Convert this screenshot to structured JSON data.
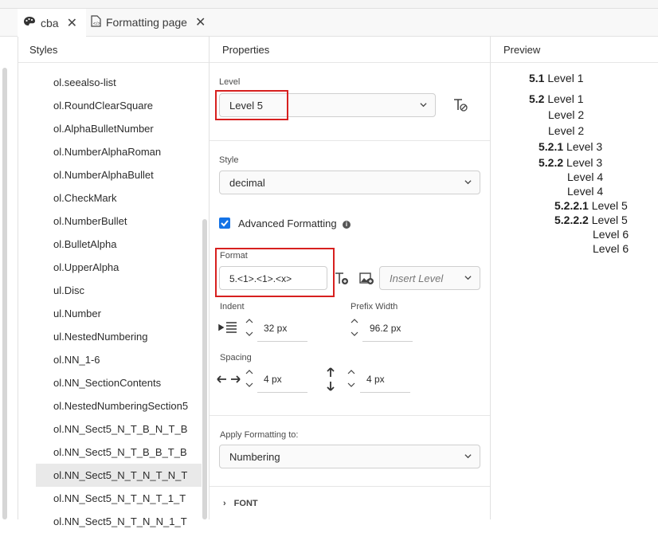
{
  "tabs": [
    {
      "label": "cba",
      "icon": "palette-icon",
      "close": "✕"
    },
    {
      "label": "Formatting page",
      "icon": "html-file-icon",
      "close": "✕"
    }
  ],
  "panels": {
    "styles": "Styles",
    "properties": "Properties",
    "preview": "Preview"
  },
  "styles_list": [
    "ol.seealso-list",
    "ol.RoundClearSquare",
    "ol.AlphaBulletNumber",
    "ol.NumberAlphaRoman",
    "ol.NumberAlphaBullet",
    "ol.CheckMark",
    "ol.NumberBullet",
    "ol.BulletAlpha",
    "ol.UpperAlpha",
    "ul.Disc",
    "ul.Number",
    "ul.NestedNumbering",
    "ol.NN_1-6",
    "ol.NN_SectionContents",
    "ol.NestedNumberingSection5",
    "ol.NN_Sect5_N_T_B_N_T_B",
    "ol.NN_Sect5_N_T_B_B_T_B",
    "ol.NN_Sect5_N_T_N_T_N_T",
    "ol.NN_Sect5_N_T_N_T_1_T",
    "ol.NN_Sect5_N_T_N_N_1_T"
  ],
  "selected_style_index": 17,
  "properties": {
    "level_label": "Level",
    "level_value": "Level 5",
    "style_label": "Style",
    "style_value": "decimal",
    "advanced_label": "Advanced Formatting",
    "advanced_checked": true,
    "format_label": "Format",
    "format_value": "5.<1>.<1>.<x>",
    "insert_level_placeholder": "Insert Level",
    "indent_label": "Indent",
    "indent_value": "32 px",
    "prefix_label": "Prefix Width",
    "prefix_value": "96.2 px",
    "spacing_label": "Spacing",
    "spacing_h_value": "4 px",
    "spacing_v_value": "4 px",
    "apply_label": "Apply Formatting to:",
    "apply_value": "Numbering",
    "font_section": "FONT"
  },
  "preview": [
    {
      "num": "5.1",
      "text": "Level 1"
    },
    {
      "num": "5.2",
      "text": "Level 1"
    },
    {
      "num": "",
      "text": "Level 2"
    },
    {
      "num": "",
      "text": "Level 2"
    },
    {
      "num": "5.2.1",
      "text": "Level 3"
    },
    {
      "num": "5.2.2",
      "text": "Level 3"
    },
    {
      "num": "",
      "text": "Level 4"
    },
    {
      "num": "",
      "text": "Level 4"
    },
    {
      "num": "5.2.2.1",
      "text": "Level 5"
    },
    {
      "num": "5.2.2.2",
      "text": "Level 5"
    },
    {
      "num": "",
      "text": "Level 6"
    },
    {
      "num": "",
      "text": "Level 6"
    }
  ],
  "colors": {
    "accent": "#1473e6",
    "highlight": "#d7201f",
    "selected_row": "#e9e9e9"
  }
}
